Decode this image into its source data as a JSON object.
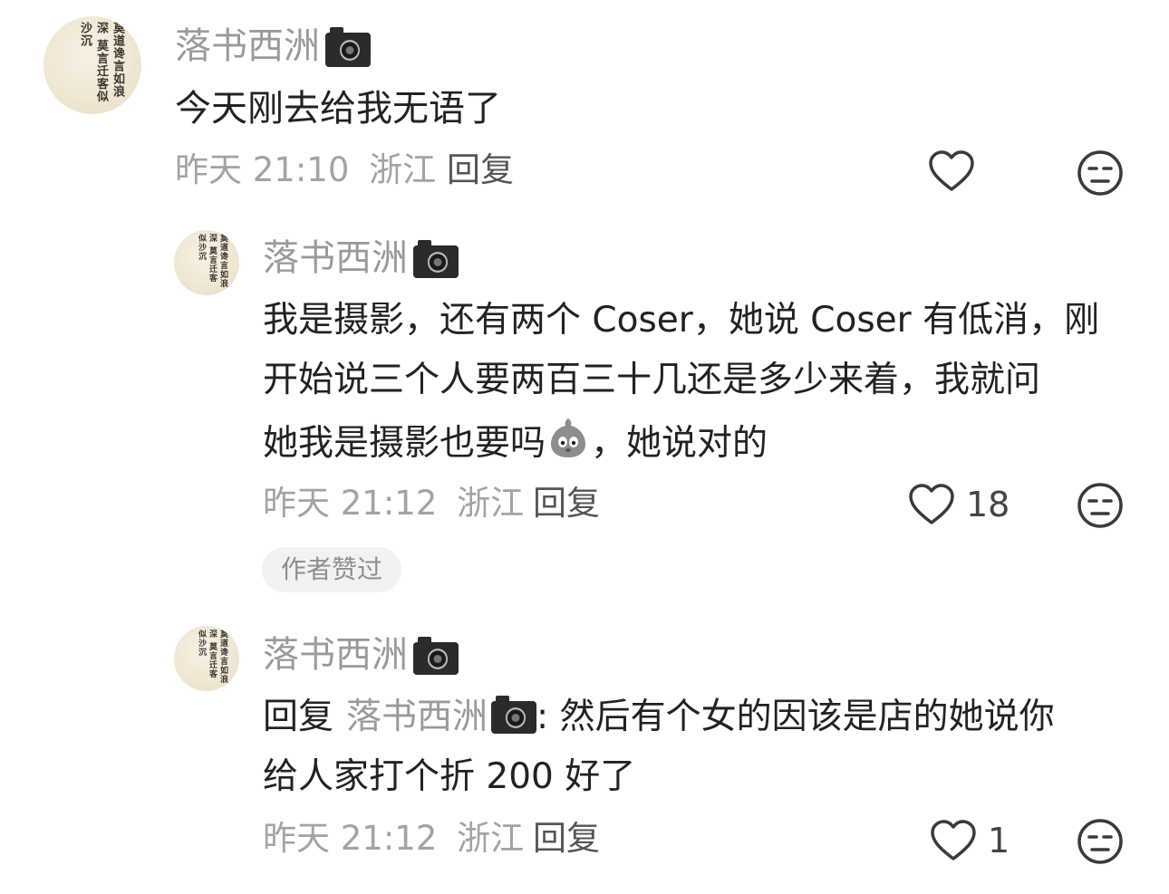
{
  "comments": [
    {
      "username": "落书西洲",
      "text": "今天刚去给我无语了",
      "time": "昨天 21:10",
      "location": "浙江",
      "reply_label": "回复",
      "like_count": ""
    },
    {
      "username": "落书西洲",
      "lines": [
        "我是摄影，还有两个 Coser，她说 Coser 有低消，刚",
        "开始说三个人要两百三十几还是多少来着，我就问",
        "她我是摄影也要吗",
        "，她说对的"
      ],
      "time": "昨天 21:12",
      "location": "浙江",
      "reply_label": "回复",
      "like_count": "18",
      "badge": "作者赞过"
    },
    {
      "username": "落书西洲",
      "reply_prefix": "回复",
      "mention": "落书西洲",
      "lines": [
        ": 然后有个女的因该是店的她说你",
        "给人家打个折 200 好了"
      ],
      "time": "昨天 21:12",
      "location": "浙江",
      "reply_label": "回复",
      "like_count": "1"
    }
  ],
  "avatar_text": "莫道谗言如浪深 莫言迁客似沙沉",
  "icons": {
    "verified": "camera-icon",
    "like": "heart-outline-icon",
    "dislike": "unamused-face-icon",
    "sticker": "grey-bird-sticker-icon"
  },
  "colors": {
    "text": "#222222",
    "muted": "#9a9a9a",
    "badge_bg": "#f2f2f2"
  }
}
